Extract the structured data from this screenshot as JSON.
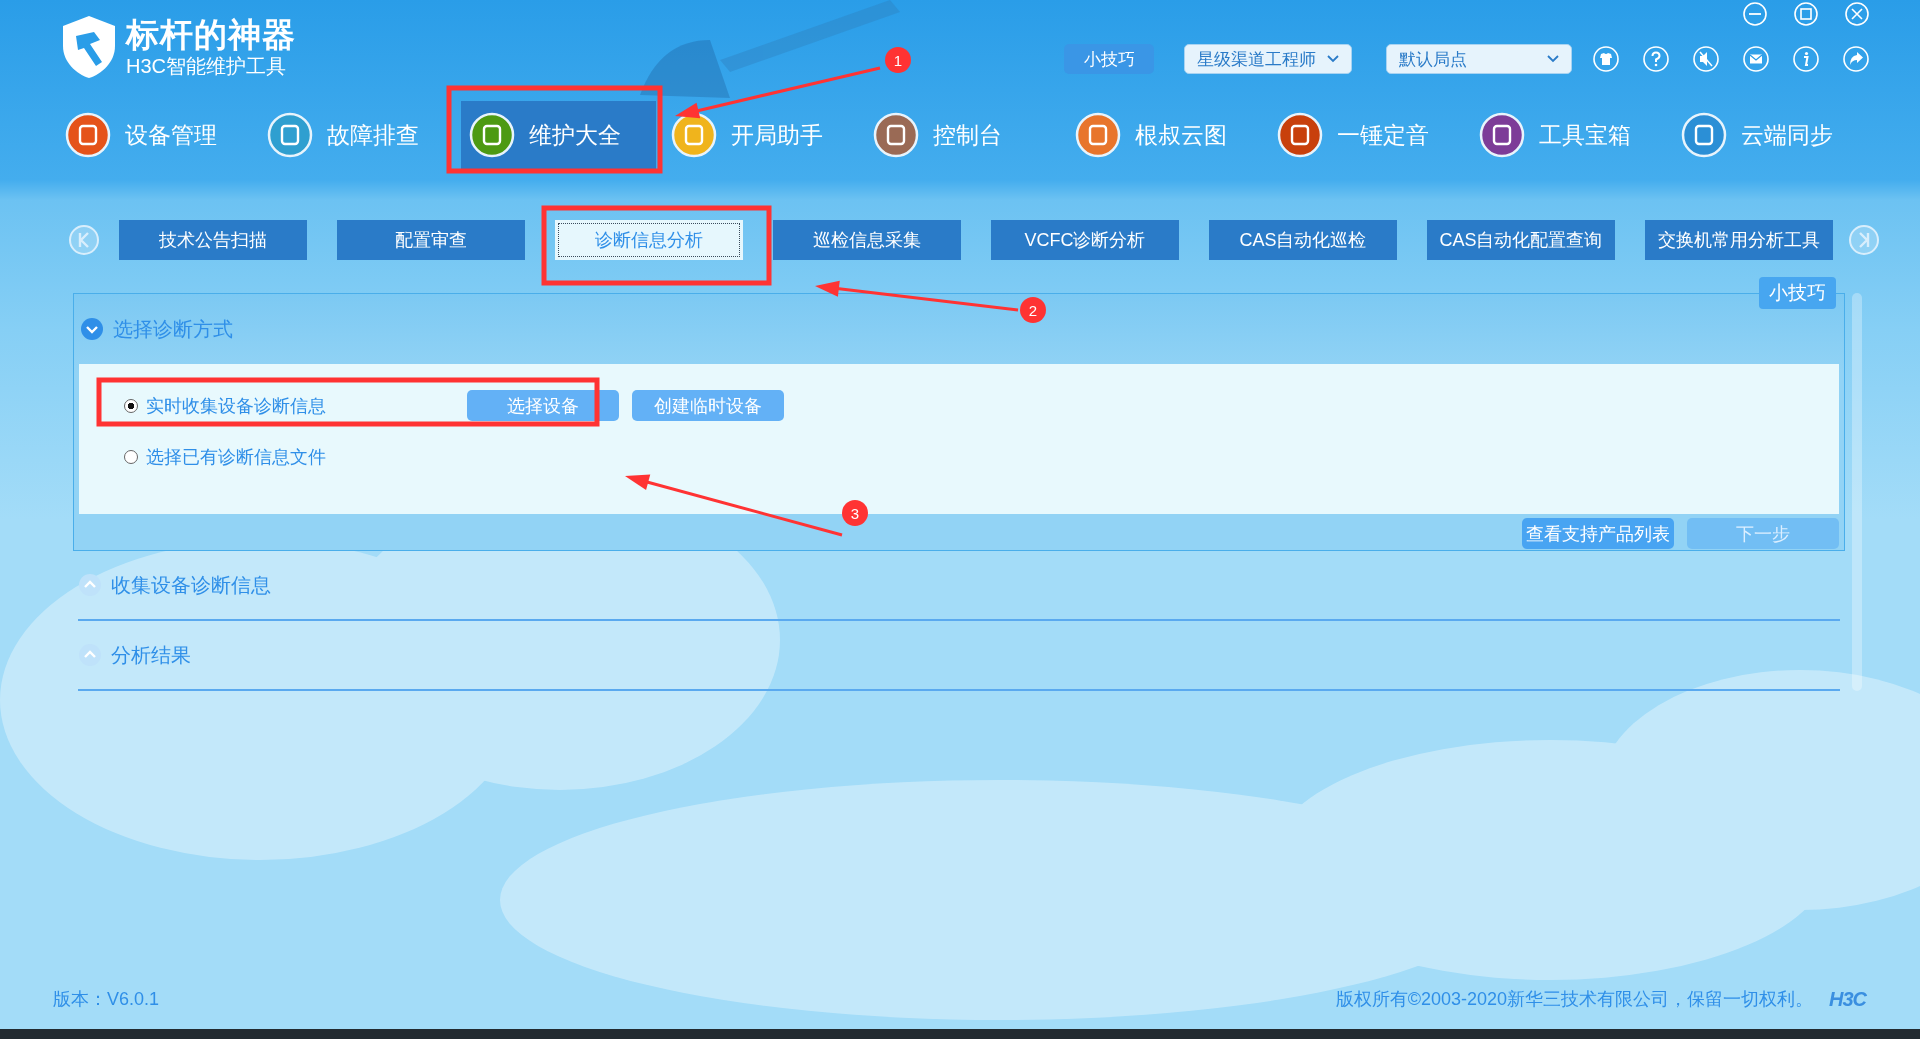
{
  "app": {
    "title": "标杆的神器",
    "subtitle": "H3C智能维护工具"
  },
  "toolbar": {
    "tips_button": "小技巧",
    "role_dropdown": {
      "value": "星级渠道工程师"
    },
    "site_dropdown": {
      "value": "默认局点"
    }
  },
  "main_nav": [
    {
      "label": "设备管理",
      "color": "#e5531a",
      "selected": false
    },
    {
      "label": "故障排查",
      "color": "#2f9fd0",
      "selected": false
    },
    {
      "label": "维护大全",
      "color": "#4d9a12",
      "selected": true
    },
    {
      "label": "开局助手",
      "color": "#f0b41c",
      "selected": false
    },
    {
      "label": "控制台",
      "color": "#9a6a55",
      "selected": false
    },
    {
      "label": "根叔云图",
      "color": "#e8752c",
      "selected": false
    },
    {
      "label": "一锤定音",
      "color": "#c8400c",
      "selected": false
    },
    {
      "label": "工具宝箱",
      "color": "#7d3c98",
      "selected": false
    },
    {
      "label": "云端同步",
      "color": "#2b8fd6",
      "selected": false
    }
  ],
  "sub_tabs": [
    {
      "label": "技术公告扫描",
      "selected": false
    },
    {
      "label": "配置审查",
      "selected": false
    },
    {
      "label": "诊断信息分析",
      "selected": true
    },
    {
      "label": "巡检信息采集",
      "selected": false
    },
    {
      "label": "VCFC诊断分析",
      "selected": false
    },
    {
      "label": "CAS自动化巡检",
      "selected": false
    },
    {
      "label": "CAS自动化配置查询",
      "selected": false
    },
    {
      "label": "交换机常用分析工具",
      "selected": false
    }
  ],
  "panel": {
    "tips_tag": "小技巧",
    "sections": [
      {
        "title": "选择诊断方式",
        "expanded": true,
        "options": [
          {
            "label": "实时收集设备诊断信息",
            "selected": true,
            "buttons": [
              "选择设备",
              "创建临时设备"
            ]
          },
          {
            "label": "选择已有诊断信息文件",
            "selected": false
          }
        ],
        "footer_buttons": [
          {
            "label": "查看支持产品列表",
            "disabled": false
          },
          {
            "label": "下一步",
            "disabled": true
          }
        ]
      },
      {
        "title": "收集设备诊断信息",
        "expanded": false
      },
      {
        "title": "分析结果",
        "expanded": false
      }
    ]
  },
  "footer": {
    "version": "版本：V6.0.1",
    "copyright": "版权所有©2003-2020新华三技术有限公司，保留一切权利。",
    "logo": "H3C"
  },
  "annotations": [
    {
      "number": "1"
    },
    {
      "number": "2"
    },
    {
      "number": "3"
    }
  ]
}
